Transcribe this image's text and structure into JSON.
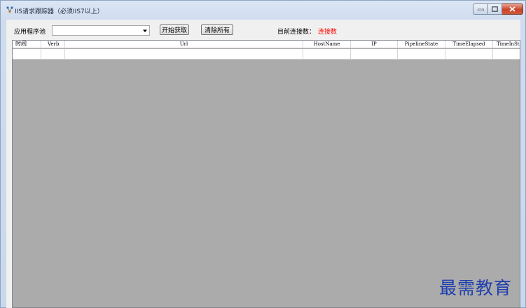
{
  "window": {
    "title": "IIS请求跟踪器（必须IIS7以上）",
    "icon": "network-icon"
  },
  "toolbar": {
    "app_pool_label": "应用程序池",
    "app_pool_value": "",
    "start_button": "开始获取",
    "clear_button": "清除所有",
    "connections_label": "目前连接数：",
    "connections_value": "连接数"
  },
  "table": {
    "columns": [
      "时间",
      "Verb",
      "Url",
      "HostName",
      "IP",
      "PipelineState",
      "TimeElapsed",
      "TimeInState"
    ],
    "rows": [
      [
        "",
        "",
        "",
        "",
        "",
        "",
        "",
        ""
      ]
    ]
  },
  "watermark": "最需教育",
  "colors": {
    "connections_value": "#ff0000",
    "grid_background": "#ababab",
    "watermark": "#1f3fae"
  }
}
